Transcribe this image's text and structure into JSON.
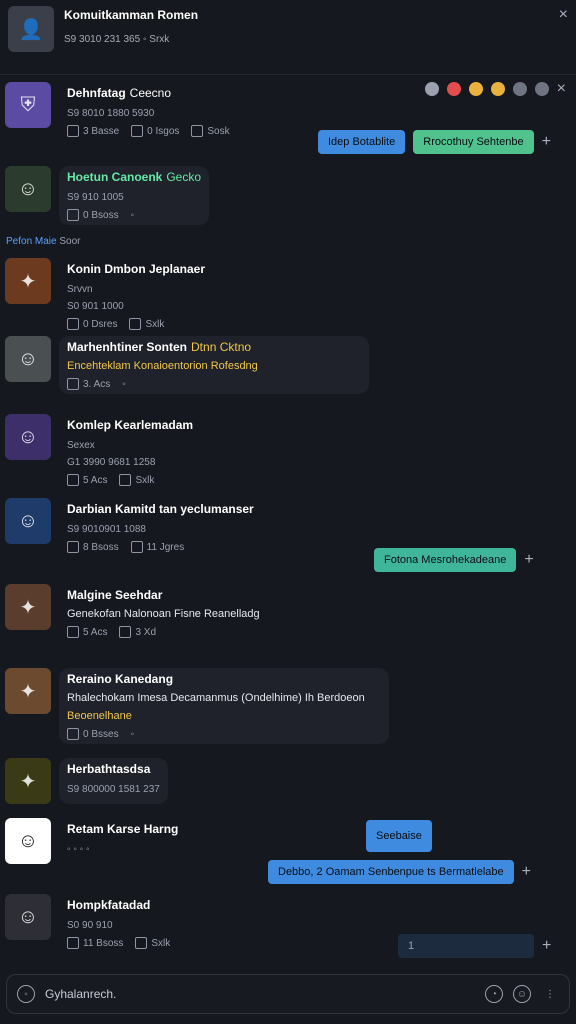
{
  "header": {
    "title": "Komuitkamman Romen",
    "subtitle": "S9 3010 231 365   ◦  Srxk",
    "close": "×"
  },
  "top_reactions": [
    "•",
    "•",
    "•",
    "•",
    "•",
    "•"
  ],
  "system": {
    "label": "Pefon Maie",
    "suffix": "Soor"
  },
  "messages": [
    {
      "name": "Dehnfatag",
      "badges": "Ceecno",
      "line1": "S9 8010 1880 5930",
      "meta": [
        "3 Basse",
        "0 Isgos",
        "Sosk"
      ]
    },
    {
      "name": "Hoetun Canoenk",
      "badges": "Gecko",
      "line1": "S9 910 1005",
      "meta": [
        "0 Bsoss",
        "◦"
      ]
    },
    {
      "name": "Konin Dmbon Jeplanaer",
      "badges": "",
      "line1": "Srvvn",
      "line2": "S0 901 1000",
      "meta": [
        "0 Dsres",
        "Sxlk"
      ]
    },
    {
      "name": "Marhenhtiner Sonten",
      "badges": "Dtnn  Cktno",
      "line1": "Encehteklam Konaioentorion Rofesdng",
      "meta": [
        "3. Acs",
        "◦"
      ]
    },
    {
      "name": "Komlep Kearlemadam",
      "badges": "",
      "line1": "Sexex",
      "line2": "G1 3990 9681 1258",
      "meta": [
        "5 Acs",
        "Sxlk"
      ]
    },
    {
      "name": "Darbian Kamitd tan yeclumanser",
      "badges": "",
      "line1": "S9 9010901 1088",
      "meta": [
        "8 Bsoss",
        "11 Jgres"
      ]
    },
    {
      "name": "Malgine Seehdar",
      "badges": "",
      "line1": "Genekofan Nalonoan Fisne Reanelladg",
      "meta": [
        "5 Acs",
        "3 Xd"
      ]
    },
    {
      "name": "Reraino Kanedang",
      "badges": "",
      "line1": "Rhalechokam Imesa Decamanmus (Ondelhime) Ih Berdoeon",
      "line2": "Beoenelhane",
      "meta": [
        "0 Bsses",
        "◦"
      ]
    },
    {
      "name": "Herbathtasdsa",
      "badges": "",
      "line1": "S9 800000 1581 237",
      "meta": []
    },
    {
      "name": "Retam Karse Harng",
      "badges": "",
      "line1": "◦ ◦ ◦ ◦",
      "meta": []
    },
    {
      "name": "Hompkfatadad",
      "badges": "",
      "line1": "S0 90 910",
      "meta": [
        "11 Bsoss",
        "Sxlk"
      ]
    }
  ],
  "replies": [
    {
      "chips": [
        "Idep Botablite",
        "Rrocothuy Sehtenbe"
      ]
    },
    {
      "chips": [
        "Fotona Mesrohekadeane"
      ]
    },
    {
      "chips": [
        "Seebaise"
      ]
    },
    {
      "chips": [
        "Debbo, 2 Oamam Senbenpue ts Bermatlelabe"
      ]
    },
    {
      "chips": [
        "1"
      ]
    }
  ],
  "composer": {
    "placeholder": "Gyhalanrech."
  }
}
